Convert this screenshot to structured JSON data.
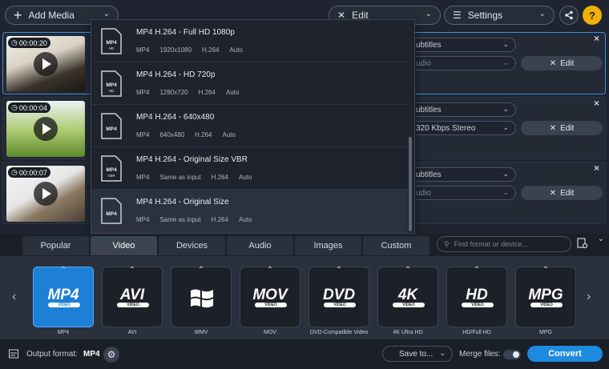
{
  "toolbar": {
    "add_media": "Add Media",
    "edit": "Edit",
    "settings": "Settings",
    "help": "?"
  },
  "rows": [
    {
      "time": "00:00:20",
      "subtitles": "ubtitles",
      "audio": "udio",
      "edit": "Edit"
    },
    {
      "time": "00:00:04",
      "subtitles": "ubtitles",
      "audio": "320 Kbps Stereo",
      "edit": "Edit"
    },
    {
      "time": "00:00:07",
      "subtitles": "ubtitles",
      "audio": "udio",
      "edit": "Edit"
    }
  ],
  "presets": [
    {
      "title": "MP4 H.264 - Full HD 1080p",
      "icon_tag": "HD",
      "meta": [
        "MP4",
        "1920x1080",
        "H.264",
        "Auto"
      ]
    },
    {
      "title": "MP4 H.264 - HD 720p",
      "icon_tag": "HD",
      "meta": [
        "MP4",
        "1280x720",
        "H.264",
        "Auto"
      ]
    },
    {
      "title": "MP4 H.264 - 640x480",
      "icon_tag": "",
      "meta": [
        "MP4",
        "640x480",
        "H.264",
        "Auto"
      ]
    },
    {
      "title": "MP4 H.264 - Original Size VBR",
      "icon_tag": "VBR",
      "meta": [
        "MP4",
        "Same as input",
        "H.264",
        "Auto"
      ]
    },
    {
      "title": "MP4 H.264 - Original Size",
      "icon_tag": "",
      "meta": [
        "MP4",
        "Same as input",
        "H.264",
        "Auto"
      ]
    }
  ],
  "preset_icon_label": "MP4",
  "tabs": [
    "Popular",
    "Video",
    "Devices",
    "Audio",
    "Images",
    "Custom"
  ],
  "search_placeholder": "Find format or device...",
  "formats": [
    {
      "logo": "MP4",
      "band": "VIDEO",
      "label": "MP4"
    },
    {
      "logo": "AVI",
      "band": "VIDEO",
      "label": "AVI"
    },
    {
      "logo": "",
      "band": "",
      "label": "WMV"
    },
    {
      "logo": "MOV",
      "band": "VIDEO",
      "label": "MOV"
    },
    {
      "logo": "DVD",
      "band": "VIDEO",
      "label": "DVD-Compatible Video"
    },
    {
      "logo": "4K",
      "band": "VIDEO",
      "label": "4K Ultra HD"
    },
    {
      "logo": "HD",
      "band": "VIDEO",
      "label": "HD/Full HD"
    },
    {
      "logo": "MPG",
      "band": "VIDEO",
      "label": "MPG"
    }
  ],
  "bottom": {
    "output_label": "Output format:",
    "output_value": "MP4",
    "save_to": "Save to...",
    "merge": "Merge files:",
    "convert": "Convert"
  },
  "colors": {
    "accent": "#1d8be0",
    "help": "#f0b000"
  }
}
